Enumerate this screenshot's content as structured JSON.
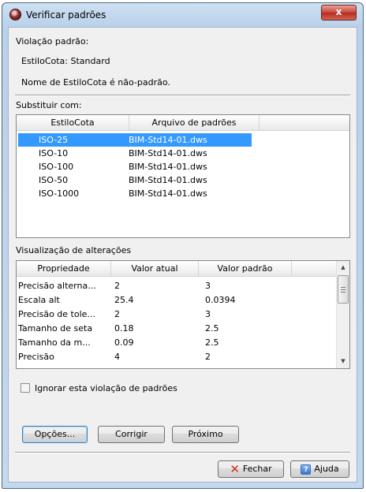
{
  "window": {
    "title": "Verificar padrões",
    "close_glyph": "x",
    "app_icon": "autocad-standards-icon"
  },
  "violation": {
    "header": "Violação padrão:",
    "style_line": "EstiloCota: Standard",
    "description": "Nome de EstiloCota é não-padrão."
  },
  "replace": {
    "header": "Substituir com:",
    "columns": [
      "EstiloCota",
      "Arquivo de padrões"
    ],
    "selected_index": 0,
    "rows": [
      {
        "style": "ISO-25",
        "file": "BIM-Std14-01.dws"
      },
      {
        "style": "ISO-10",
        "file": "BIM-Std14-01.dws"
      },
      {
        "style": "ISO-100",
        "file": "BIM-Std14-01.dws"
      },
      {
        "style": "ISO-50",
        "file": "BIM-Std14-01.dws"
      },
      {
        "style": "ISO-1000",
        "file": "BIM-Std14-01.dws"
      }
    ]
  },
  "preview": {
    "header": "Visualização de alterações",
    "columns": [
      "Propriedade",
      "Valor atual",
      "Valor padrão"
    ],
    "rows": [
      {
        "property": "Precisão alterna...",
        "current": "2",
        "standard": "3"
      },
      {
        "property": "Escala alt",
        "current": "25.4",
        "standard": "0.0394"
      },
      {
        "property": "Precisão de tole...",
        "current": "2",
        "standard": "3"
      },
      {
        "property": "Tamanho de seta",
        "current": "0.18",
        "standard": "2.5"
      },
      {
        "property": "Tamanho da m...",
        "current": "0.09",
        "standard": "2.5"
      },
      {
        "property": "Precisão",
        "current": "4",
        "standard": "2"
      }
    ]
  },
  "ignore_checkbox": {
    "label": "Ignorar esta violação de padrões",
    "checked": false
  },
  "buttons": {
    "options": "Opções...",
    "fix": "Corrigir",
    "next": "Próximo",
    "close": "Fechar",
    "help": "Ajuda",
    "help_glyph": "?"
  },
  "colors": {
    "selection": "#3399ff",
    "close_button": "#c8453a",
    "title_bar": "#b9d1ea"
  }
}
